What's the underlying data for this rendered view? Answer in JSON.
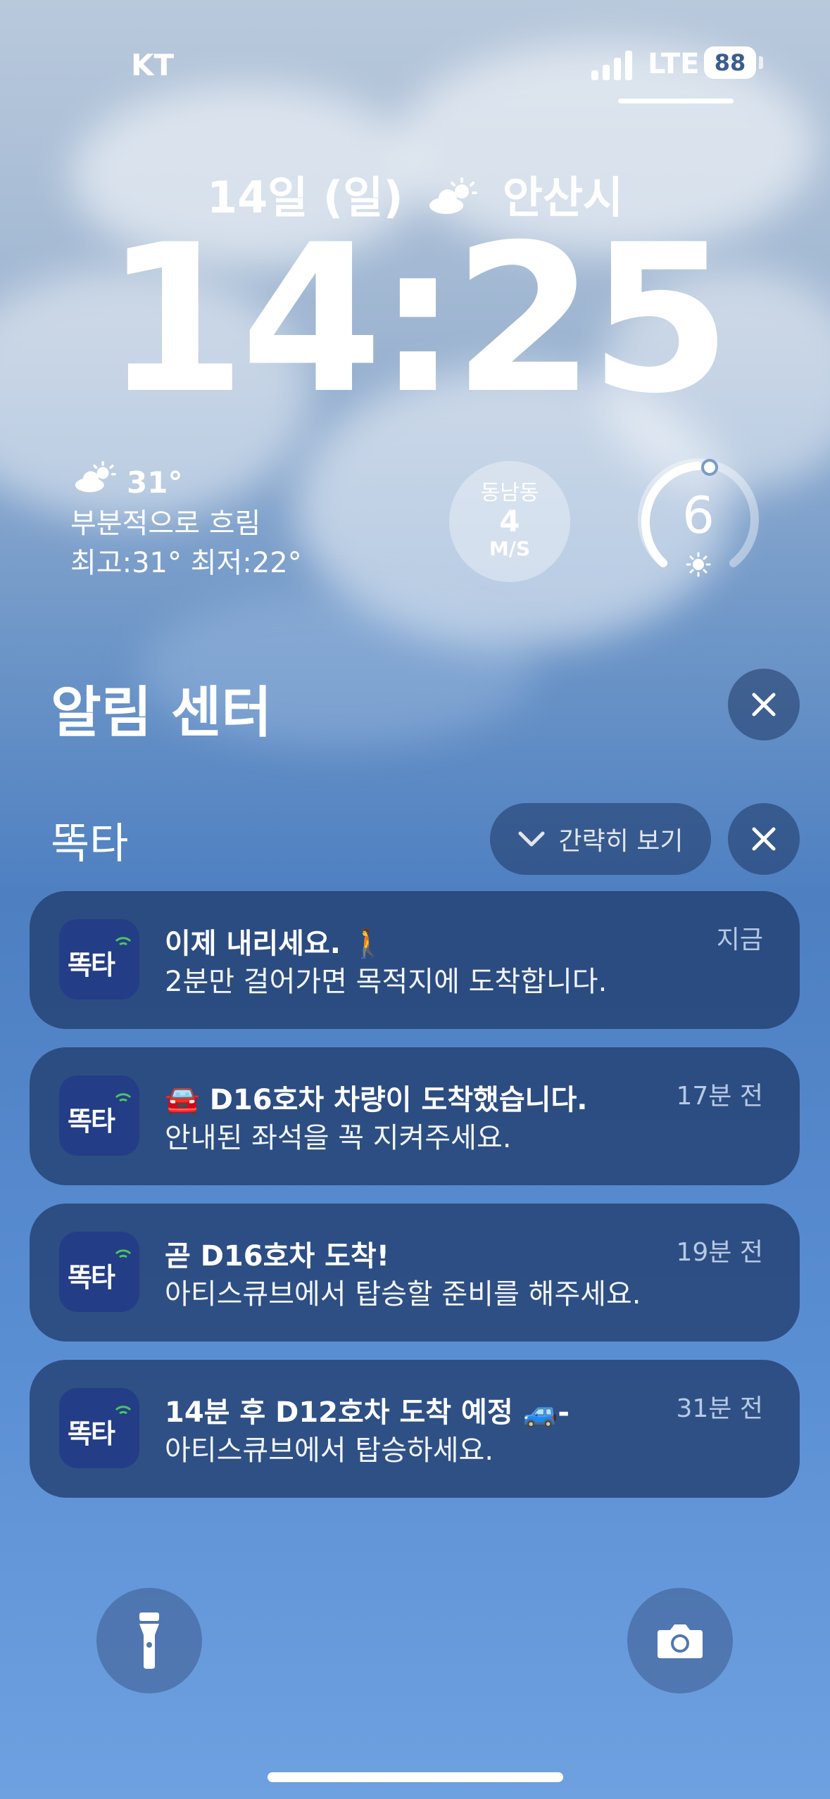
{
  "status": {
    "carrier": "KT",
    "network": "LTE",
    "battery": "88"
  },
  "lock": {
    "date": "14일 (일)",
    "location": "안산시",
    "time": "14:25"
  },
  "weather": {
    "temp": "31°",
    "condition": "부분적으로 흐림",
    "range": "최고:31° 최저:22°"
  },
  "wind": {
    "direction": "동남동",
    "speed": "4",
    "unit": "M/S"
  },
  "uv": {
    "index": "6"
  },
  "notification_center": {
    "title": "알림 센터",
    "app_name": "똑타",
    "collapse_label": "간략히 보기"
  },
  "notifications": [
    {
      "title": "이제 내리세요. 🚶",
      "body": "2분만 걸어가면 목적지에 도착합니다.",
      "time": "지금"
    },
    {
      "title": "🚘 D16호차 차량이 도착했습니다.",
      "body": "안내된 좌석을 꼭 지켜주세요.",
      "time": "17분 전"
    },
    {
      "title": "곧 D16호차 도착!",
      "body": "아티스큐브에서 탑승할 준비를 해주세요.",
      "time": "19분 전"
    },
    {
      "title": "14분 후 D12호차 도착 예정 🚙-",
      "body": "아티스큐브에서 탑승하세요.",
      "time": "31분 전"
    }
  ],
  "app_icon_text": "똑타",
  "icons": {
    "weather": "partly-cloudy-sun-icon",
    "close": "close-icon",
    "chevron": "chevron-down-icon",
    "flashlight": "flashlight-icon",
    "camera": "camera-icon"
  }
}
